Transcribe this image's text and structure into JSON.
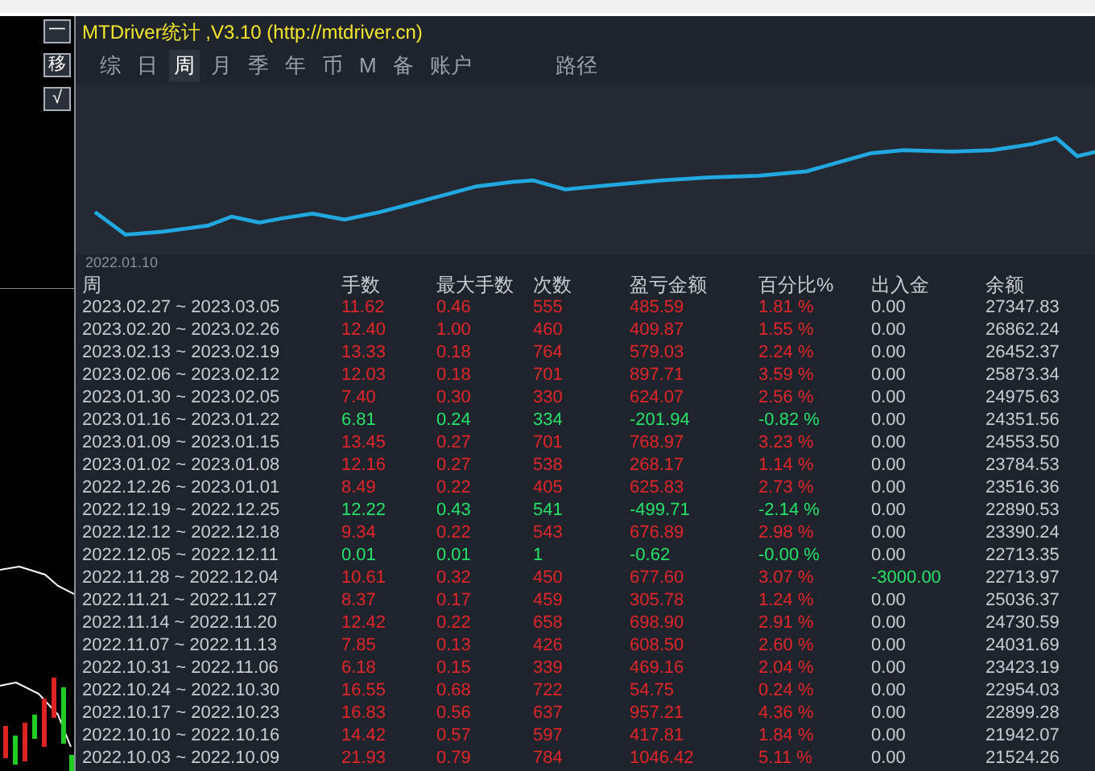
{
  "side_buttons": [
    "一",
    "移",
    "√"
  ],
  "window": {
    "title": "MTDriver统计 ,V3.10 (http://mtdriver.cn)"
  },
  "tabs": [
    {
      "label": "综",
      "selected": false
    },
    {
      "label": "日",
      "selected": false
    },
    {
      "label": "周",
      "selected": true
    },
    {
      "label": "月",
      "selected": false
    },
    {
      "label": "季",
      "selected": false
    },
    {
      "label": "年",
      "selected": false
    },
    {
      "label": "币",
      "selected": false
    },
    {
      "label": "M",
      "selected": false
    },
    {
      "label": "备",
      "selected": false
    },
    {
      "label": "账户",
      "selected": false
    }
  ],
  "path_label": "路径",
  "chart": {
    "start_label": "2022.01.10"
  },
  "table": {
    "columns": [
      "周",
      "手数",
      "最大手数",
      "次数",
      "盈亏金额",
      "百分比%",
      "出入金",
      "余额"
    ],
    "rows": [
      {
        "kind": "gain",
        "week": "2023.02.27 ~ 2023.03.05",
        "lots": "11.62",
        "max_lots": "0.46",
        "trades": "555",
        "profit": "485.59",
        "percent": "1.81 %",
        "deposit": "0.00",
        "deposit_flow": false,
        "balance": "27347.83"
      },
      {
        "kind": "gain",
        "week": "2023.02.20 ~ 2023.02.26",
        "lots": "12.40",
        "max_lots": "1.00",
        "trades": "460",
        "profit": "409.87",
        "percent": "1.55 %",
        "deposit": "0.00",
        "deposit_flow": false,
        "balance": "26862.24"
      },
      {
        "kind": "gain",
        "week": "2023.02.13 ~ 2023.02.19",
        "lots": "13.33",
        "max_lots": "0.18",
        "trades": "764",
        "profit": "579.03",
        "percent": "2.24 %",
        "deposit": "0.00",
        "deposit_flow": false,
        "balance": "26452.37"
      },
      {
        "kind": "gain",
        "week": "2023.02.06 ~ 2023.02.12",
        "lots": "12.03",
        "max_lots": "0.18",
        "trades": "701",
        "profit": "897.71",
        "percent": "3.59 %",
        "deposit": "0.00",
        "deposit_flow": false,
        "balance": "25873.34"
      },
      {
        "kind": "gain",
        "week": "2023.01.30 ~ 2023.02.05",
        "lots": "7.40",
        "max_lots": "0.30",
        "trades": "330",
        "profit": "624.07",
        "percent": "2.56 %",
        "deposit": "0.00",
        "deposit_flow": false,
        "balance": "24975.63"
      },
      {
        "kind": "loss",
        "week": "2023.01.16 ~ 2023.01.22",
        "lots": "6.81",
        "max_lots": "0.24",
        "trades": "334",
        "profit": "-201.94",
        "percent": "-0.82 %",
        "deposit": "0.00",
        "deposit_flow": false,
        "balance": "24351.56"
      },
      {
        "kind": "gain",
        "week": "2023.01.09 ~ 2023.01.15",
        "lots": "13.45",
        "max_lots": "0.27",
        "trades": "701",
        "profit": "768.97",
        "percent": "3.23 %",
        "deposit": "0.00",
        "deposit_flow": false,
        "balance": "24553.50"
      },
      {
        "kind": "gain",
        "week": "2023.01.02 ~ 2023.01.08",
        "lots": "12.16",
        "max_lots": "0.27",
        "trades": "538",
        "profit": "268.17",
        "percent": "1.14 %",
        "deposit": "0.00",
        "deposit_flow": false,
        "balance": "23784.53"
      },
      {
        "kind": "gain",
        "week": "2022.12.26 ~ 2023.01.01",
        "lots": "8.49",
        "max_lots": "0.22",
        "trades": "405",
        "profit": "625.83",
        "percent": "2.73 %",
        "deposit": "0.00",
        "deposit_flow": false,
        "balance": "23516.36"
      },
      {
        "kind": "loss",
        "week": "2022.12.19 ~ 2022.12.25",
        "lots": "12.22",
        "max_lots": "0.43",
        "trades": "541",
        "profit": "-499.71",
        "percent": "-2.14 %",
        "deposit": "0.00",
        "deposit_flow": false,
        "balance": "22890.53"
      },
      {
        "kind": "gain",
        "week": "2022.12.12 ~ 2022.12.18",
        "lots": "9.34",
        "max_lots": "0.22",
        "trades": "543",
        "profit": "676.89",
        "percent": "2.98 %",
        "deposit": "0.00",
        "deposit_flow": false,
        "balance": "23390.24"
      },
      {
        "kind": "loss",
        "week": "2022.12.05 ~ 2022.12.11",
        "lots": "0.01",
        "max_lots": "0.01",
        "trades": "1",
        "profit": "-0.62",
        "percent": "-0.00 %",
        "deposit": "0.00",
        "deposit_flow": false,
        "balance": "22713.35"
      },
      {
        "kind": "gain",
        "week": "2022.11.28 ~ 2022.12.04",
        "lots": "10.61",
        "max_lots": "0.32",
        "trades": "450",
        "profit": "677.60",
        "percent": "3.07 %",
        "deposit": "-3000.00",
        "deposit_flow": true,
        "balance": "22713.97"
      },
      {
        "kind": "gain",
        "week": "2022.11.21 ~ 2022.11.27",
        "lots": "8.37",
        "max_lots": "0.17",
        "trades": "459",
        "profit": "305.78",
        "percent": "1.24 %",
        "deposit": "0.00",
        "deposit_flow": false,
        "balance": "25036.37"
      },
      {
        "kind": "gain",
        "week": "2022.11.14 ~ 2022.11.20",
        "lots": "12.42",
        "max_lots": "0.22",
        "trades": "658",
        "profit": "698.90",
        "percent": "2.91 %",
        "deposit": "0.00",
        "deposit_flow": false,
        "balance": "24730.59"
      },
      {
        "kind": "gain",
        "week": "2022.11.07 ~ 2022.11.13",
        "lots": "7.85",
        "max_lots": "0.13",
        "trades": "426",
        "profit": "608.50",
        "percent": "2.60 %",
        "deposit": "0.00",
        "deposit_flow": false,
        "balance": "24031.69"
      },
      {
        "kind": "gain",
        "week": "2022.10.31 ~ 2022.11.06",
        "lots": "6.18",
        "max_lots": "0.15",
        "trades": "339",
        "profit": "469.16",
        "percent": "2.04 %",
        "deposit": "0.00",
        "deposit_flow": false,
        "balance": "23423.19"
      },
      {
        "kind": "gain",
        "week": "2022.10.24 ~ 2022.10.30",
        "lots": "16.55",
        "max_lots": "0.68",
        "trades": "722",
        "profit": "54.75",
        "percent": "0.24 %",
        "deposit": "0.00",
        "deposit_flow": false,
        "balance": "22954.03"
      },
      {
        "kind": "gain",
        "week": "2022.10.17 ~ 2022.10.23",
        "lots": "16.83",
        "max_lots": "0.56",
        "trades": "637",
        "profit": "957.21",
        "percent": "4.36 %",
        "deposit": "0.00",
        "deposit_flow": false,
        "balance": "22899.28"
      },
      {
        "kind": "gain",
        "week": "2022.10.10 ~ 2022.10.16",
        "lots": "14.42",
        "max_lots": "0.57",
        "trades": "597",
        "profit": "417.81",
        "percent": "1.84 %",
        "deposit": "0.00",
        "deposit_flow": false,
        "balance": "21942.07"
      },
      {
        "kind": "gain",
        "week": "2022.10.03 ~ 2022.10.09",
        "lots": "21.93",
        "max_lots": "0.79",
        "trades": "784",
        "profit": "1046.42",
        "percent": "5.11 %",
        "deposit": "0.00",
        "deposit_flow": false,
        "balance": "21524.26"
      }
    ]
  }
}
